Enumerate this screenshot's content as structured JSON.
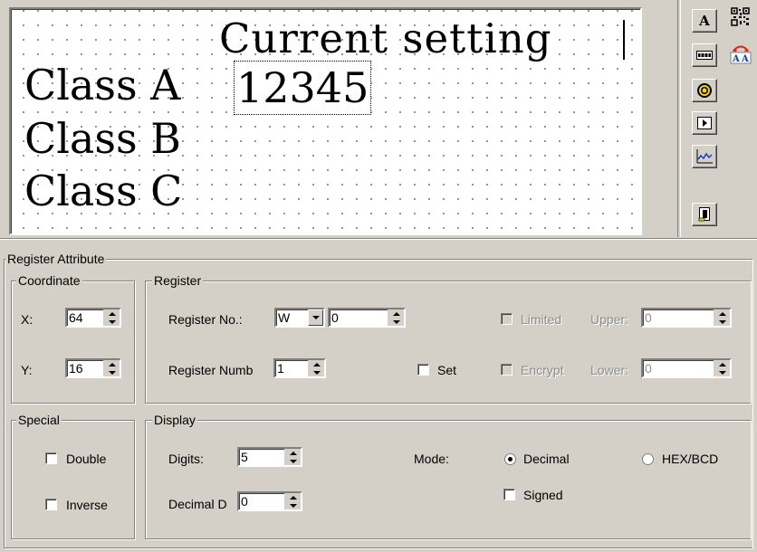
{
  "canvas": {
    "title": "Current setting",
    "rows": [
      "Class A",
      "Class B",
      "Class C"
    ],
    "value": "12345"
  },
  "toolbar": {
    "buttons": [
      {
        "icon": "text-tool-icon"
      },
      {
        "icon": "qr-code-icon"
      },
      {
        "icon": "numeric-display-icon"
      },
      {
        "icon": "font-size-icon"
      },
      {
        "icon": "lamp-icon"
      },
      {
        "icon": "play-button-icon"
      },
      {
        "icon": "trend-chart-icon"
      },
      {
        "icon": "screen-jump-icon"
      }
    ]
  },
  "panel": {
    "title": "Register Attribute",
    "coordinate": {
      "legend": "Coordinate",
      "x_label": "X:",
      "x_value": "64",
      "y_label": "Y:",
      "y_value": "16"
    },
    "register": {
      "legend": "Register",
      "reg_no_label": "Register No.:",
      "reg_type": "W",
      "reg_no_value": "0",
      "reg_number_label": "Register Numb",
      "reg_number_value": "1",
      "set_label": "Set",
      "limited_label": "Limited",
      "upper_label": "Upper:",
      "upper_value": "0",
      "encrypt_label": "Encrypt",
      "lower_label": "Lower:",
      "lower_value": "0"
    },
    "special": {
      "legend": "Special",
      "double_label": "Double",
      "inverse_label": "Inverse"
    },
    "display": {
      "legend": "Display",
      "digits_label": "Digits:",
      "digits_value": "5",
      "decimal_label": "Decimal D",
      "decimal_value": "0",
      "mode_label": "Mode:",
      "decimal_radio": "Decimal",
      "hex_radio": "HEX/BCD",
      "signed_label": "Signed",
      "mode_selected": "Decimal"
    }
  }
}
